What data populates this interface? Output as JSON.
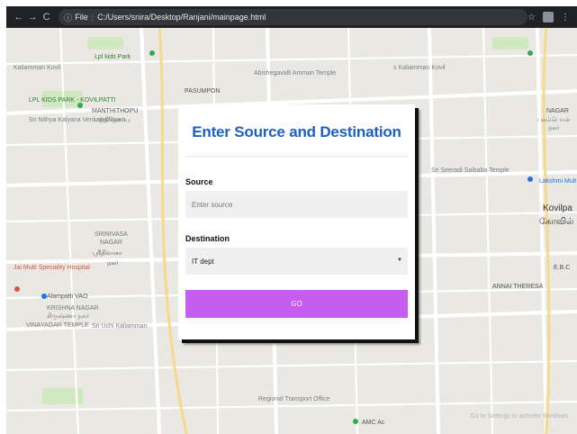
{
  "browser": {
    "back": "←",
    "forward": "→",
    "reload": "C",
    "info_icon": "ⓘ",
    "file_label": "File",
    "separator": "|",
    "url": "C:/Users/snira/Desktop/Ranjani/mainpage.html",
    "star": "☆",
    "menu": "⋮"
  },
  "map": {
    "labels": [
      "Kaliamman Kovil",
      "Lpl kids Park",
      "Abishegavalli Amman Temple",
      "s Kaliamman Kovil",
      "LPL KIDS PARK - KOVILPATTI",
      "MANTHITHOPU",
      "மந்திதோப்பு",
      "PASUMPON",
      "NAGAR",
      "பசும்பொன்",
      "நகர்",
      "Sri Nithya Kalyana Venkateshwara...",
      "Sri Seeradi Saibaba Temple",
      "Lakshmi Mult",
      "Kovilpa",
      "கோவில்",
      "SRINIVASA",
      "NAGAR",
      "ஸ்ரீநிவாசா",
      "நகர்",
      "Jai Multi Speciality Hospital",
      "ANNAI THERESA",
      "E.B.C",
      "Alampatti VAO",
      "KRISHNA NAGAR",
      "கிருஷ்ணா நகர்",
      "VINAYAGAR TEMPLE",
      "Sri Uchi Kaliamman",
      "Regional Transport Office",
      "AMC Ac",
      "Go to Settings to activate Windows."
    ]
  },
  "form": {
    "title": "Enter Source and Destination",
    "source_label": "Source",
    "source_placeholder": "Enter source",
    "destination_label": "Destination",
    "destination_value": "IT dept",
    "go_label": "GO"
  },
  "colors": {
    "title": "#1f5fbf",
    "go_button": "#c65cf0",
    "map_bg": "#e9e8e3",
    "road": "#ffffff",
    "park": "#c9e7b8"
  }
}
